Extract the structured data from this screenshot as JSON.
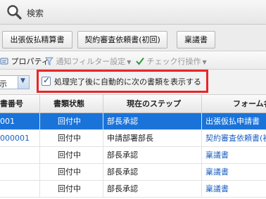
{
  "search": {
    "title": "検索"
  },
  "doc_tabs": [
    "出張仮払精算書",
    "契約審査依頼書(初回)",
    "稟議書"
  ],
  "toolbar": {
    "properties": "プロパティ",
    "notice_filter": "通知フィルター設定",
    "check_action": "チェック行操作"
  },
  "options": {
    "display_value": "示",
    "auto_display_label": "処理完了後に自動的に次の書類を表示する",
    "auto_display_checked": true
  },
  "table": {
    "headers": [
      "書番号",
      "書類状態",
      "現在のステップ",
      "フォーム名"
    ],
    "rows": [
      {
        "num": "001",
        "status": "回付中",
        "step": "部長承認",
        "form": "出張仮払申請書",
        "selected": true
      },
      {
        "num": "000001",
        "status": "回付中",
        "step": "申請部署部長",
        "form": "契約審査依頼書(初回)",
        "selected": false
      },
      {
        "num": "",
        "status": "回付中",
        "step": "部長承認",
        "form": "稟議書",
        "selected": false
      },
      {
        "num": "",
        "status": "回付中",
        "step": "部長承認",
        "form": "稟議書",
        "selected": false
      },
      {
        "num": "",
        "status": "回付中",
        "step": "部長承認",
        "form": "稟議書",
        "selected": false
      }
    ]
  }
}
